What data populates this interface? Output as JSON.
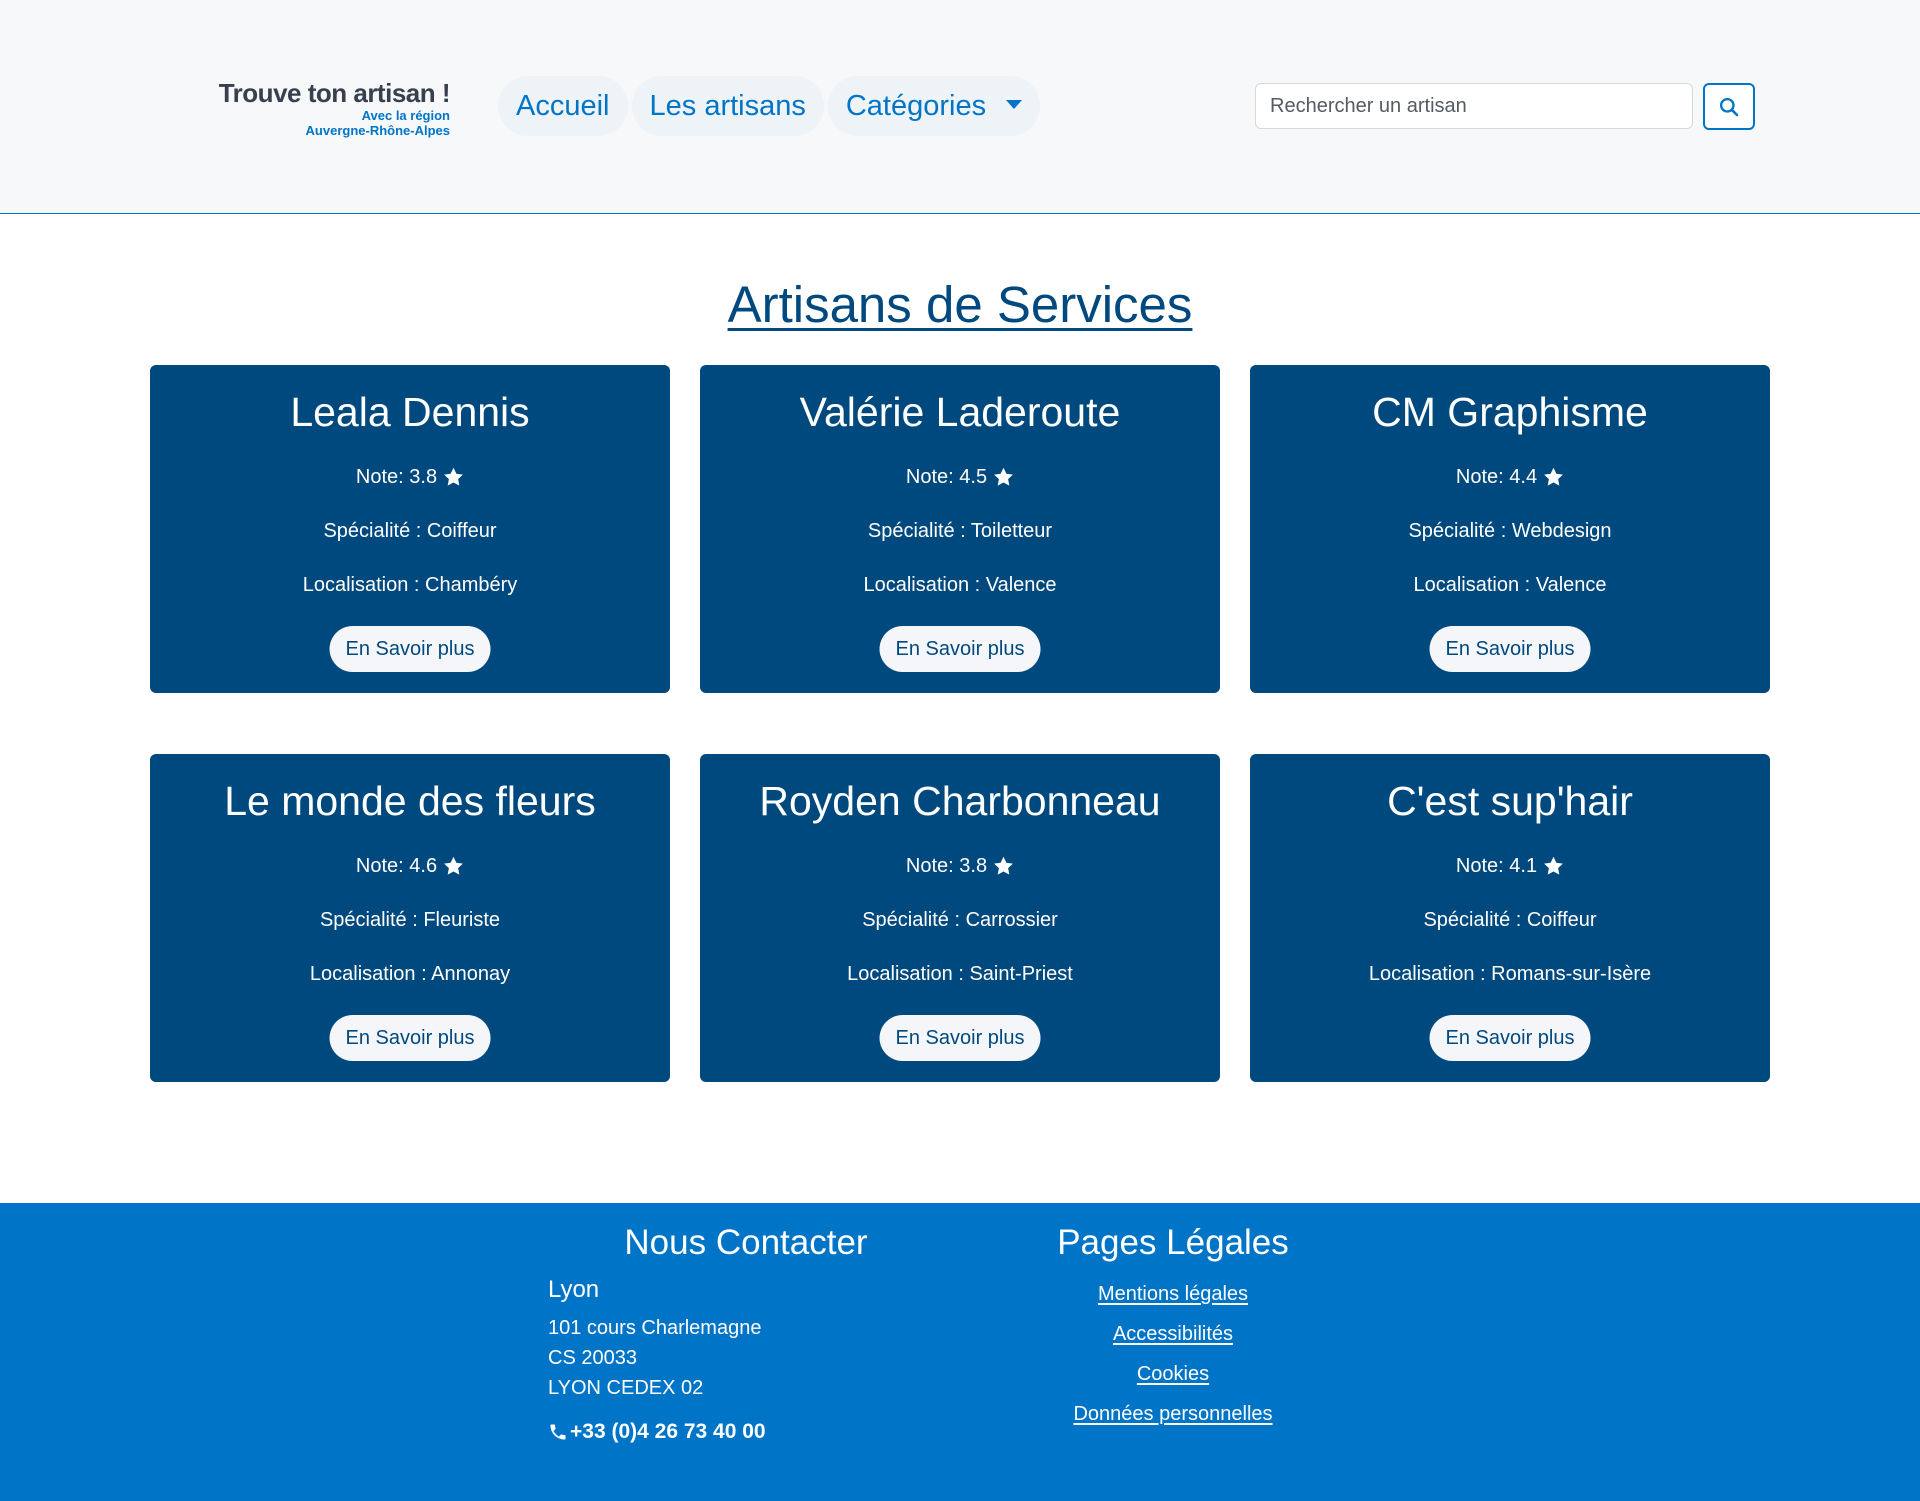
{
  "header": {
    "logo": {
      "title": "Trouve ton artisan !",
      "subtitle_line1": "Avec la région",
      "subtitle_line2": "Auvergne-Rhône-Alpes"
    },
    "nav": {
      "items": [
        {
          "label": "Accueil"
        },
        {
          "label": "Les artisans"
        },
        {
          "label": "Catégories"
        }
      ]
    },
    "search": {
      "placeholder": "Rechercher un artisan",
      "value": "",
      "button_icon": "search-icon"
    }
  },
  "main": {
    "title": "Artisans de Services",
    "cards": [
      {
        "name": "Leala Dennis",
        "rating_label": "Note: 3.8",
        "specialty_label": "Spécialité : Coiffeur",
        "location_label": "Localisation : Chambéry",
        "button_label": "En Savoir plus"
      },
      {
        "name": "Valérie Laderoute",
        "rating_label": "Note: 4.5",
        "specialty_label": "Spécialité : Toiletteur",
        "location_label": "Localisation : Valence",
        "button_label": "En Savoir plus"
      },
      {
        "name": "CM Graphisme",
        "rating_label": "Note: 4.4",
        "specialty_label": "Spécialité : Webdesign",
        "location_label": "Localisation : Valence",
        "button_label": "En Savoir plus"
      },
      {
        "name": "Le monde des fleurs",
        "rating_label": "Note: 4.6",
        "specialty_label": "Spécialité : Fleuriste",
        "location_label": "Localisation : Annonay",
        "button_label": "En Savoir plus"
      },
      {
        "name": "Royden Charbonneau",
        "rating_label": "Note: 3.8",
        "specialty_label": "Spécialité : Carrossier",
        "location_label": "Localisation : Saint-Priest",
        "button_label": "En Savoir plus"
      },
      {
        "name": "C'est sup'hair",
        "rating_label": "Note: 4.1",
        "specialty_label": "Spécialité : Coiffeur",
        "location_label": "Localisation : Romans-sur-Isère",
        "button_label": "En Savoir plus"
      }
    ]
  },
  "footer": {
    "contact": {
      "heading": "Nous Contacter",
      "city": "Lyon",
      "address_lines": [
        "101 cours Charlemagne",
        "CS 20033",
        "LYON CEDEX 02"
      ],
      "phone": "+33 (0)4 26 73 40 00",
      "phone_icon": "phone-icon"
    },
    "legal": {
      "heading": "Pages Légales",
      "links": [
        {
          "label": "Mentions légales"
        },
        {
          "label": "Accessibilités"
        },
        {
          "label": "Cookies"
        },
        {
          "label": "Données personnelles"
        }
      ]
    }
  },
  "colors": {
    "header_background": "#f6f8fa",
    "nav_link": "#0074c7",
    "card_background": "#00497e",
    "title": "#00497e",
    "footer_background": "#0074c7",
    "button_background": "#f4f6f9"
  }
}
